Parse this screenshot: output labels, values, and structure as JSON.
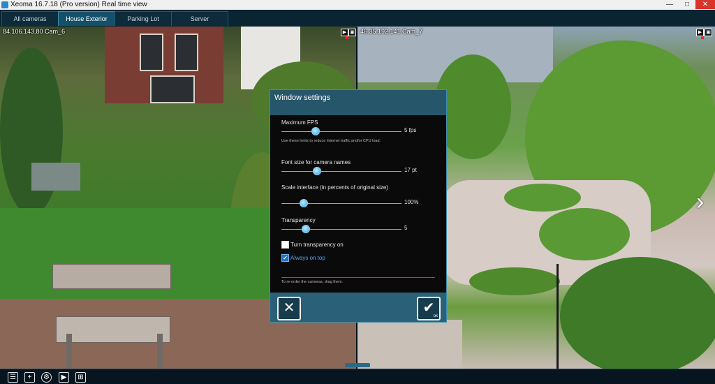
{
  "window": {
    "title": "Xeoma 16.7.18 (Pro version) Real time view",
    "min_glyph": "—",
    "max_glyph": "□",
    "close_glyph": "✕"
  },
  "tabs": [
    {
      "label": "All cameras",
      "active": false
    },
    {
      "label": "House Exterior",
      "active": true
    },
    {
      "label": "Parking Lot",
      "active": false
    },
    {
      "label": "Server",
      "active": false
    }
  ],
  "cameras": [
    {
      "name": "84.106.143.80 Cam_6",
      "play_glyph": "▶",
      "settings_glyph": "▣"
    },
    {
      "name": "46.35.192.141 Cam_7",
      "play_glyph": "▶",
      "settings_glyph": "▣"
    }
  ],
  "next_arrow": "›",
  "dialog": {
    "title": "Window settings",
    "max_fps": {
      "label": "Maximum FPS",
      "value": "5 fps",
      "level": 0.28,
      "note": "Use these limits to reduce Internet traffic and/or CPU load."
    },
    "font_size": {
      "label": "Font size for camera names",
      "value": "17 pt",
      "level": 0.29
    },
    "scale": {
      "label": "Scale interface (in percents of original size)",
      "value": "100%",
      "level": 0.18
    },
    "transparency": {
      "label": "Transparency",
      "value": "5",
      "level": 0.2
    },
    "turn_transparency": {
      "label": "Turn transparency on",
      "checked": false
    },
    "always_on_top": {
      "label": "Always on top",
      "checked": true,
      "glyph": "✔"
    },
    "reorder_hint": "To re-order the cameras, drag them.",
    "cancel_glyph": "✕",
    "ok_glyph": "✔",
    "ok_text": "ok"
  },
  "toolbar": {
    "list_glyph": "☰",
    "add_glyph": "+",
    "settings_glyph": "⚙",
    "play_glyph": "▶",
    "grid_glyph": "⊞"
  },
  "colors": {
    "accent": "#3aa5d6",
    "header": "#26566a",
    "close_red": "#d8352b"
  }
}
